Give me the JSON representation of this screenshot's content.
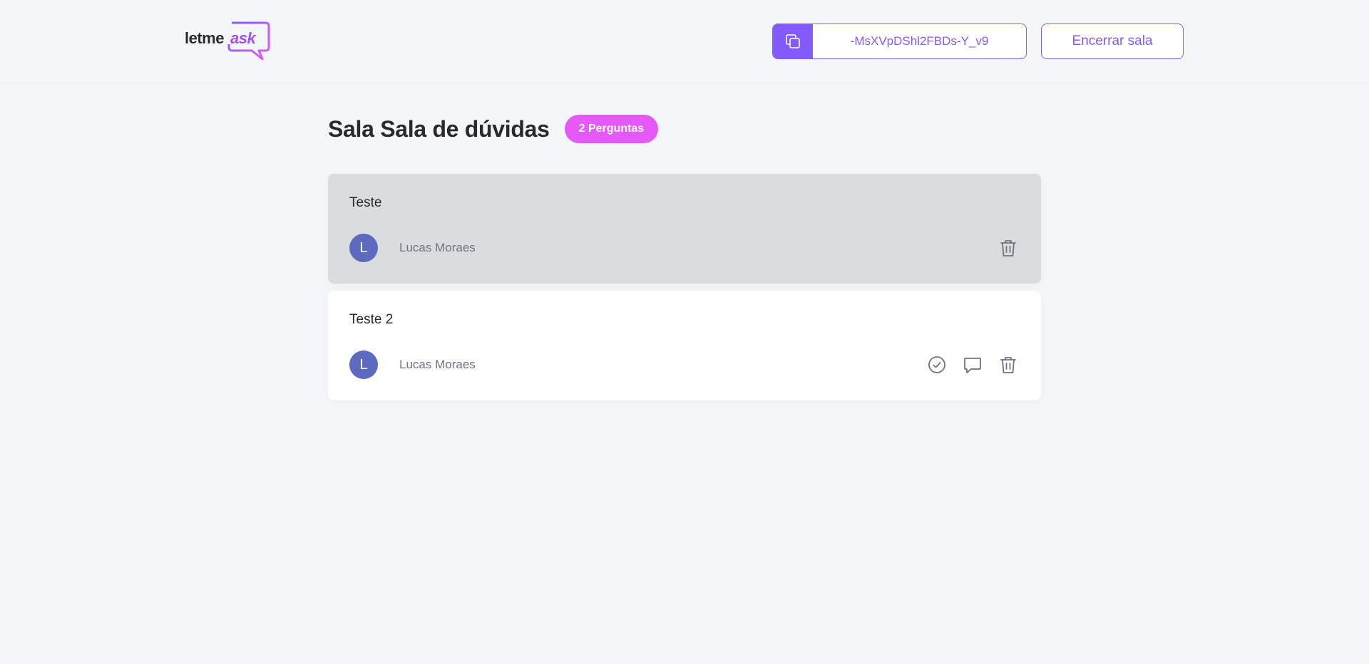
{
  "header": {
    "logo": {
      "part1": "letme",
      "part2": "ask"
    },
    "room_code": {
      "icon": "copy-icon",
      "code": "-MsXVpDShl2FBDs-Y_v9"
    },
    "close_room_label": "Encerrar sala"
  },
  "main": {
    "title": "Sala Sala de dúvidas",
    "question_count_label": "2 Perguntas",
    "questions": [
      {
        "content": "Teste",
        "author": "Lucas Moraes",
        "avatar_initial": "L",
        "highlighted": true,
        "actions": [
          "trash-icon"
        ]
      },
      {
        "content": "Teste 2",
        "author": "Lucas Moraes",
        "avatar_initial": "L",
        "highlighted": false,
        "actions": [
          "check-circle-icon",
          "comment-icon",
          "trash-icon"
        ]
      }
    ]
  },
  "colors": {
    "accent": "#835afd",
    "badge": "#e559f9",
    "highlight_bg": "#dbdcdd",
    "avatar": "#5c6bc0"
  }
}
